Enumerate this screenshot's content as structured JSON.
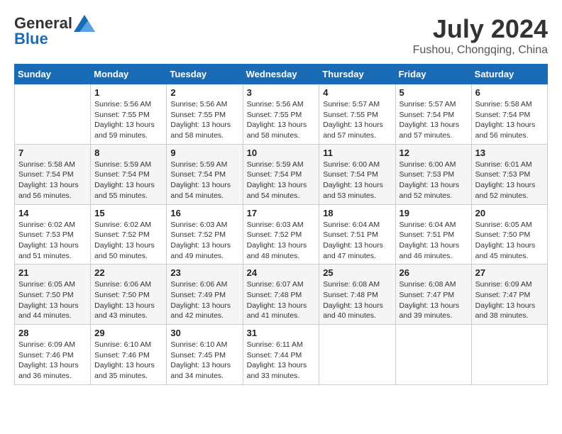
{
  "header": {
    "logo_general": "General",
    "logo_blue": "Blue",
    "month_year": "July 2024",
    "location": "Fushou, Chongqing, China"
  },
  "days_of_week": [
    "Sunday",
    "Monday",
    "Tuesday",
    "Wednesday",
    "Thursday",
    "Friday",
    "Saturday"
  ],
  "weeks": [
    [
      {
        "day": "",
        "sunrise": "",
        "sunset": "",
        "daylight": ""
      },
      {
        "day": "1",
        "sunrise": "Sunrise: 5:56 AM",
        "sunset": "Sunset: 7:55 PM",
        "daylight": "Daylight: 13 hours and 59 minutes."
      },
      {
        "day": "2",
        "sunrise": "Sunrise: 5:56 AM",
        "sunset": "Sunset: 7:55 PM",
        "daylight": "Daylight: 13 hours and 58 minutes."
      },
      {
        "day": "3",
        "sunrise": "Sunrise: 5:56 AM",
        "sunset": "Sunset: 7:55 PM",
        "daylight": "Daylight: 13 hours and 58 minutes."
      },
      {
        "day": "4",
        "sunrise": "Sunrise: 5:57 AM",
        "sunset": "Sunset: 7:55 PM",
        "daylight": "Daylight: 13 hours and 57 minutes."
      },
      {
        "day": "5",
        "sunrise": "Sunrise: 5:57 AM",
        "sunset": "Sunset: 7:54 PM",
        "daylight": "Daylight: 13 hours and 57 minutes."
      },
      {
        "day": "6",
        "sunrise": "Sunrise: 5:58 AM",
        "sunset": "Sunset: 7:54 PM",
        "daylight": "Daylight: 13 hours and 56 minutes."
      }
    ],
    [
      {
        "day": "7",
        "sunrise": "Sunrise: 5:58 AM",
        "sunset": "Sunset: 7:54 PM",
        "daylight": "Daylight: 13 hours and 56 minutes."
      },
      {
        "day": "8",
        "sunrise": "Sunrise: 5:59 AM",
        "sunset": "Sunset: 7:54 PM",
        "daylight": "Daylight: 13 hours and 55 minutes."
      },
      {
        "day": "9",
        "sunrise": "Sunrise: 5:59 AM",
        "sunset": "Sunset: 7:54 PM",
        "daylight": "Daylight: 13 hours and 54 minutes."
      },
      {
        "day": "10",
        "sunrise": "Sunrise: 5:59 AM",
        "sunset": "Sunset: 7:54 PM",
        "daylight": "Daylight: 13 hours and 54 minutes."
      },
      {
        "day": "11",
        "sunrise": "Sunrise: 6:00 AM",
        "sunset": "Sunset: 7:54 PM",
        "daylight": "Daylight: 13 hours and 53 minutes."
      },
      {
        "day": "12",
        "sunrise": "Sunrise: 6:00 AM",
        "sunset": "Sunset: 7:53 PM",
        "daylight": "Daylight: 13 hours and 52 minutes."
      },
      {
        "day": "13",
        "sunrise": "Sunrise: 6:01 AM",
        "sunset": "Sunset: 7:53 PM",
        "daylight": "Daylight: 13 hours and 52 minutes."
      }
    ],
    [
      {
        "day": "14",
        "sunrise": "Sunrise: 6:02 AM",
        "sunset": "Sunset: 7:53 PM",
        "daylight": "Daylight: 13 hours and 51 minutes."
      },
      {
        "day": "15",
        "sunrise": "Sunrise: 6:02 AM",
        "sunset": "Sunset: 7:52 PM",
        "daylight": "Daylight: 13 hours and 50 minutes."
      },
      {
        "day": "16",
        "sunrise": "Sunrise: 6:03 AM",
        "sunset": "Sunset: 7:52 PM",
        "daylight": "Daylight: 13 hours and 49 minutes."
      },
      {
        "day": "17",
        "sunrise": "Sunrise: 6:03 AM",
        "sunset": "Sunset: 7:52 PM",
        "daylight": "Daylight: 13 hours and 48 minutes."
      },
      {
        "day": "18",
        "sunrise": "Sunrise: 6:04 AM",
        "sunset": "Sunset: 7:51 PM",
        "daylight": "Daylight: 13 hours and 47 minutes."
      },
      {
        "day": "19",
        "sunrise": "Sunrise: 6:04 AM",
        "sunset": "Sunset: 7:51 PM",
        "daylight": "Daylight: 13 hours and 46 minutes."
      },
      {
        "day": "20",
        "sunrise": "Sunrise: 6:05 AM",
        "sunset": "Sunset: 7:50 PM",
        "daylight": "Daylight: 13 hours and 45 minutes."
      }
    ],
    [
      {
        "day": "21",
        "sunrise": "Sunrise: 6:05 AM",
        "sunset": "Sunset: 7:50 PM",
        "daylight": "Daylight: 13 hours and 44 minutes."
      },
      {
        "day": "22",
        "sunrise": "Sunrise: 6:06 AM",
        "sunset": "Sunset: 7:50 PM",
        "daylight": "Daylight: 13 hours and 43 minutes."
      },
      {
        "day": "23",
        "sunrise": "Sunrise: 6:06 AM",
        "sunset": "Sunset: 7:49 PM",
        "daylight": "Daylight: 13 hours and 42 minutes."
      },
      {
        "day": "24",
        "sunrise": "Sunrise: 6:07 AM",
        "sunset": "Sunset: 7:48 PM",
        "daylight": "Daylight: 13 hours and 41 minutes."
      },
      {
        "day": "25",
        "sunrise": "Sunrise: 6:08 AM",
        "sunset": "Sunset: 7:48 PM",
        "daylight": "Daylight: 13 hours and 40 minutes."
      },
      {
        "day": "26",
        "sunrise": "Sunrise: 6:08 AM",
        "sunset": "Sunset: 7:47 PM",
        "daylight": "Daylight: 13 hours and 39 minutes."
      },
      {
        "day": "27",
        "sunrise": "Sunrise: 6:09 AM",
        "sunset": "Sunset: 7:47 PM",
        "daylight": "Daylight: 13 hours and 38 minutes."
      }
    ],
    [
      {
        "day": "28",
        "sunrise": "Sunrise: 6:09 AM",
        "sunset": "Sunset: 7:46 PM",
        "daylight": "Daylight: 13 hours and 36 minutes."
      },
      {
        "day": "29",
        "sunrise": "Sunrise: 6:10 AM",
        "sunset": "Sunset: 7:46 PM",
        "daylight": "Daylight: 13 hours and 35 minutes."
      },
      {
        "day": "30",
        "sunrise": "Sunrise: 6:10 AM",
        "sunset": "Sunset: 7:45 PM",
        "daylight": "Daylight: 13 hours and 34 minutes."
      },
      {
        "day": "31",
        "sunrise": "Sunrise: 6:11 AM",
        "sunset": "Sunset: 7:44 PM",
        "daylight": "Daylight: 13 hours and 33 minutes."
      },
      {
        "day": "",
        "sunrise": "",
        "sunset": "",
        "daylight": ""
      },
      {
        "day": "",
        "sunrise": "",
        "sunset": "",
        "daylight": ""
      },
      {
        "day": "",
        "sunrise": "",
        "sunset": "",
        "daylight": ""
      }
    ]
  ]
}
